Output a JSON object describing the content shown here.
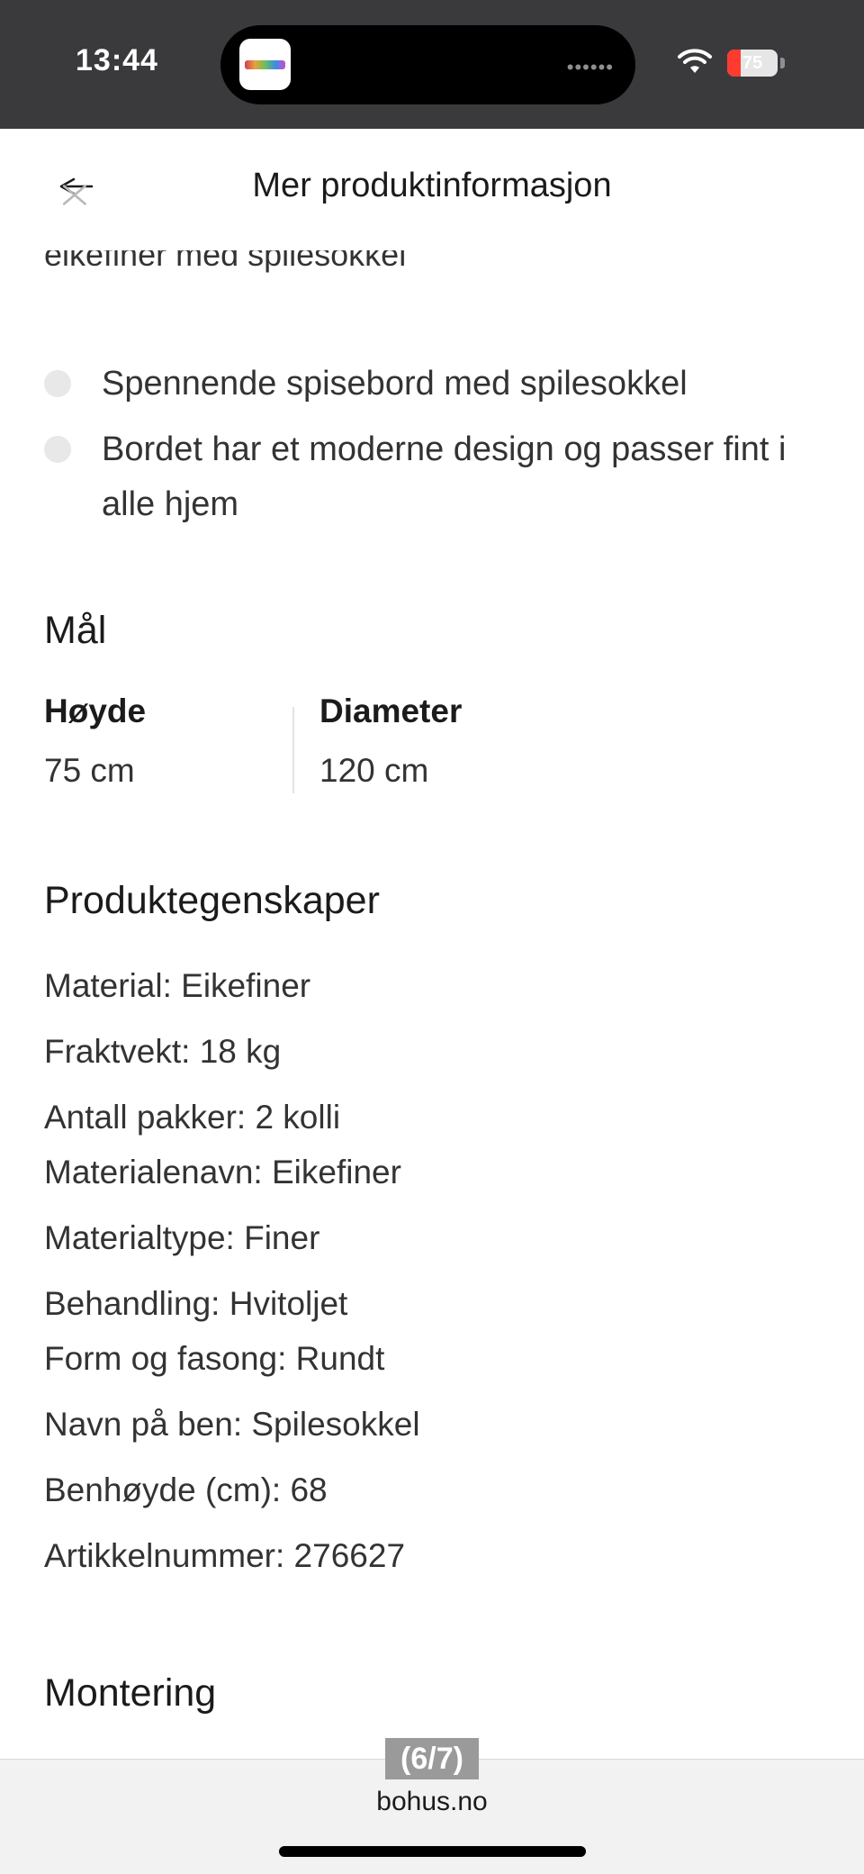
{
  "status_bar": {
    "time": "13:44",
    "battery_level": "75",
    "battery_fraction": 0.27
  },
  "header": {
    "title": "Mer produktinformasjon"
  },
  "description": {
    "clipped_line": "eikefiner med spilesokkel",
    "bullets": [
      "Spennende spisebord med spilesokkel",
      "Bordet har et moderne design og passer fint i alle hjem"
    ]
  },
  "dimensions": {
    "title": "Mål",
    "items": [
      {
        "label": "Høyde",
        "value": "75 cm"
      },
      {
        "label": "Diameter",
        "value": "120 cm"
      }
    ]
  },
  "properties": {
    "title": "Produktegenskaper",
    "items": [
      "Material: Eikefiner",
      "Fraktvekt: 18 kg",
      "Antall pakker: 2 kolli",
      "Materialenavn: Eikefiner",
      "Materialtype: Finer",
      "Behandling: Hvitoljet",
      "Form og fasong: Rundt",
      "Navn på ben: Spilesokkel",
      "Benhøyde (cm): 68",
      "Artikkelnummer: 276627"
    ]
  },
  "assembly": {
    "title": "Montering"
  },
  "browser": {
    "page_counter": "(6/7)",
    "domain": "bohus.no"
  },
  "colors": {
    "status_bar_bg": "#3a3a3c",
    "text_primary": "#1b1b1b",
    "text_secondary": "#333333",
    "bullet_dot": "#e8e8e8",
    "battery_low": "#ff3b30"
  },
  "icons": {
    "back": "arrow-left-icon",
    "close": "close-icon",
    "wifi": "wifi-icon",
    "battery": "battery-icon"
  }
}
